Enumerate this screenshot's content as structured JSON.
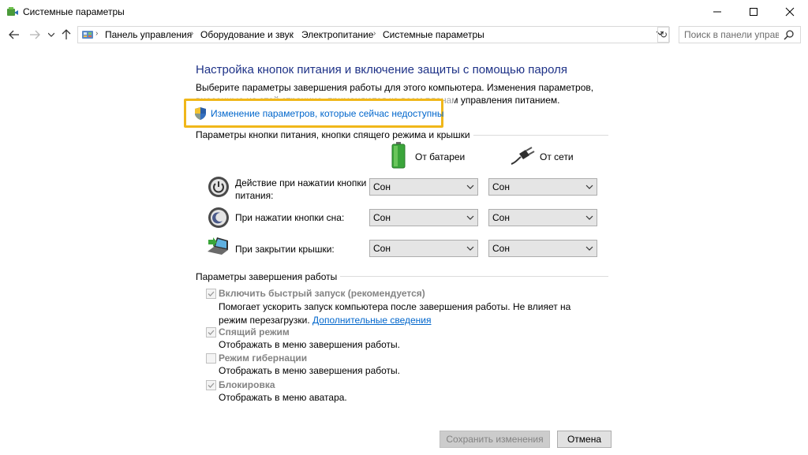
{
  "window": {
    "title": "Системные параметры"
  },
  "nav": {
    "breadcrumbs": [
      "Панель управления",
      "Оборудование и звук",
      "Электропитание",
      "Системные параметры"
    ],
    "search_placeholder": "Поиск в панели управ..."
  },
  "content": {
    "heading": "Настройка кнопок питания и включение защиты с помощью пароля",
    "description": "Выберите параметры завершения работы для этого компьютера. Изменения параметров, внесенные на этой странице, применяются ко всем планам управления питанием.",
    "change_link": "Изменение параметров, которые сейчас недоступны",
    "power_group": {
      "title": "Параметры кнопки питания, кнопки спящего режима и крышки",
      "battery_label": "От батареи",
      "ac_label": "От сети",
      "rows": [
        {
          "label": "Действие при нажатии кнопки питания:",
          "battery": "Сон",
          "ac": "Сон"
        },
        {
          "label": "При нажатии кнопки сна:",
          "battery": "Сон",
          "ac": "Сон"
        },
        {
          "label": "При закрытии крышки:",
          "battery": "Сон",
          "ac": "Сон"
        }
      ]
    },
    "shutdown_group": {
      "title": "Параметры завершения работы",
      "items": [
        {
          "label": "Включить быстрый запуск (рекомендуется)",
          "checked": true,
          "desc": "Помогает ускорить запуск компьютера после завершения работы. Не влияет на режим перезагрузки.",
          "link": "Дополнительные сведения"
        },
        {
          "label": "Спящий режим",
          "checked": true,
          "desc": "Отображать в меню завершения работы."
        },
        {
          "label": "Режим гибернации",
          "checked": false,
          "desc": "Отображать в меню завершения работы."
        },
        {
          "label": "Блокировка",
          "checked": true,
          "desc": "Отображать в меню аватара."
        }
      ]
    }
  },
  "buttons": {
    "save": "Сохранить изменения",
    "cancel": "Отмена"
  },
  "colors": {
    "heading": "#1e3287",
    "link": "#0066cc",
    "highlight": "#f0b71a",
    "disabled_text": "#838383"
  }
}
